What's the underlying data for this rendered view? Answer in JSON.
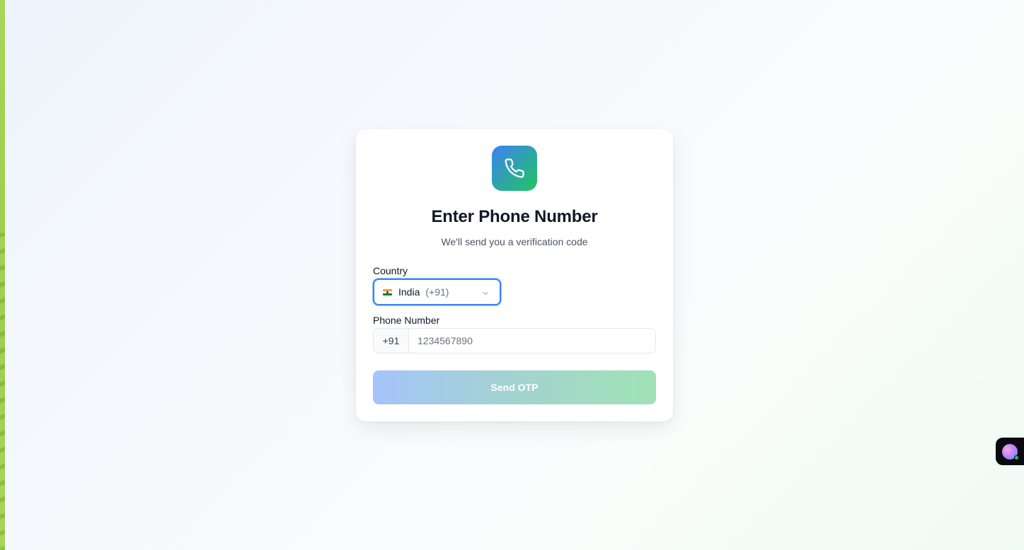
{
  "header": {
    "title": "Enter Phone Number",
    "subtitle": "We'll send you a verification code"
  },
  "country": {
    "label": "Country",
    "selected_name": "India",
    "selected_code": "(+91)",
    "flag": "india-flag"
  },
  "phone": {
    "label": "Phone Number",
    "prefix": "+91",
    "value": "",
    "placeholder": "1234567890"
  },
  "actions": {
    "send_label": "Send OTP"
  },
  "colors": {
    "accent": "#3b82f6",
    "brand_gradient_start": "#3b82f6",
    "brand_gradient_end": "#22c55e",
    "status_online": "#22c55e"
  },
  "icons": {
    "logo": "phone-icon",
    "dropdown": "chevron-down-icon",
    "assistant": "assistant-avatar-icon"
  }
}
